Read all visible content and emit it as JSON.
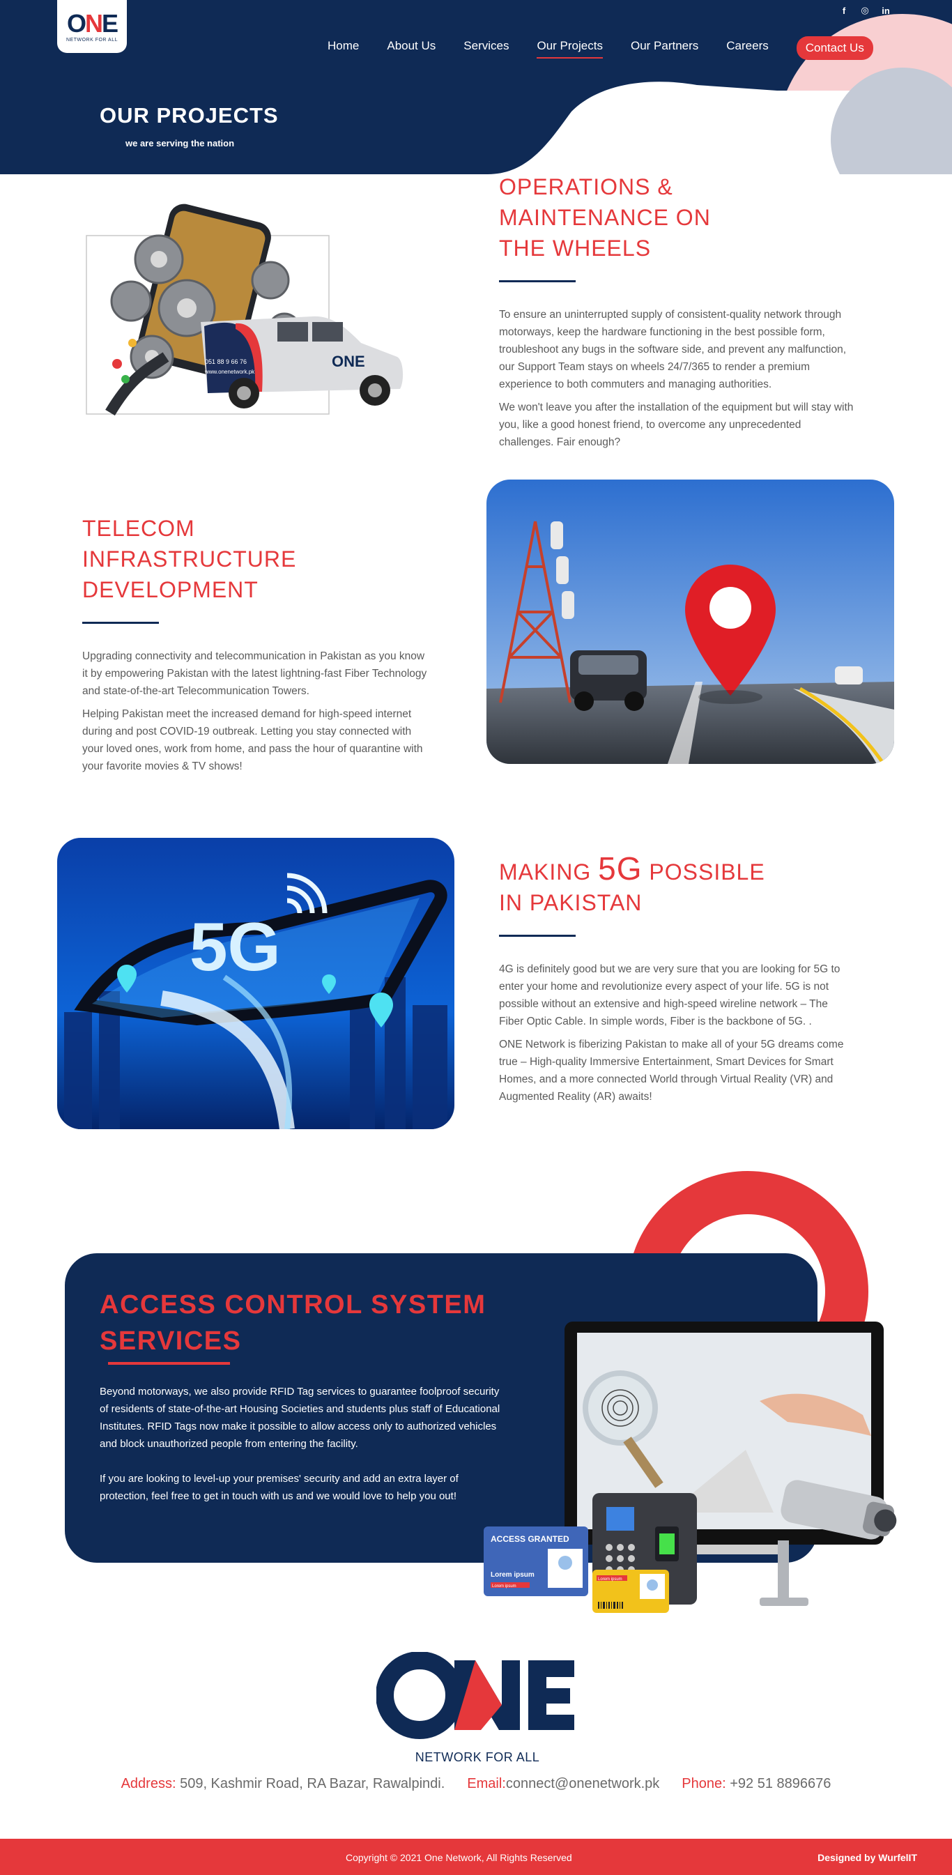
{
  "header": {
    "logo": {
      "mark": "ONE",
      "tagline": "NETWORK FOR ALL"
    },
    "social": [
      "facebook-icon",
      "instagram-icon",
      "linkedin-icon"
    ],
    "social_glyphs": {
      "facebook": "f",
      "instagram": "◎",
      "linkedin": "in"
    },
    "nav": [
      {
        "label": "Home"
      },
      {
        "label": "About Us"
      },
      {
        "label": "Services"
      },
      {
        "label": "Our Projects",
        "active": true
      },
      {
        "label": "Our Partners"
      },
      {
        "label": "Careers"
      }
    ],
    "cta": "Contact Us",
    "page_title": "OUR PROJECTS",
    "page_subtitle": "we are serving the nation"
  },
  "projects": [
    {
      "title": "OPERATIONS & MAINTENANCE ON THE WHEELS",
      "paragraphs": [
        "To ensure an uninterrupted supply of consistent-quality network through motorways, keep the hardware functioning in the best possible form, troubleshoot any bugs in the software side, and prevent any malfunction, our Support Team stays on wheels 24/7/365 to render a premium experience to both commuters and managing authorities.",
        "We won't leave you after the installation of the equipment but will stay with you, like a good honest friend, to overcome any unprecedented challenges. Fair enough?"
      ],
      "van_phone": "051 88 9 66 76",
      "van_url": "www.onenetwork.pk"
    },
    {
      "title": "TELECOM INFRASTRUCTURE DEVELOPMENT",
      "paragraphs": [
        "Upgrading connectivity and telecommunication in Pakistan as you know it by empowering Pakistan with the latest lightning-fast Fiber Technology and state-of-the-art Telecommunication Towers.",
        "Helping Pakistan meet the increased demand for high-speed internet during and post COVID-19 outbreak. Letting you stay connected with your loved ones, work from home, and pass the hour of quarantine with your favorite movies & TV shows!"
      ]
    },
    {
      "title_pre": "MAKING ",
      "title_big": "5G",
      "title_post": " POSSIBLE",
      "title_line2": "IN PAKISTAN",
      "image_label": "5G",
      "paragraphs": [
        "4G is definitely good but we are very sure that you are looking for 5G to enter your home and revolutionize every aspect of your life. 5G is not possible without an extensive and high-speed wireline network – The Fiber Optic Cable. In simple words, Fiber is the backbone of 5G. .",
        "ONE Network is fiberizing Pakistan to make all of your 5G dreams come true – High-quality Immersive Entertainment, Smart Devices for Smart Homes, and a more connected World through Virtual Reality (VR) and Augmented Reality (AR) awaits!"
      ]
    }
  ],
  "access": {
    "title_line1": "ACCESS CONTROL SYSTEM",
    "title_line2": "SERVICES",
    "paragraphs": [
      "Beyond motorways, we also provide RFID Tag services to guarantee foolproof security of residents of state-of-the-art Housing Societies and students plus staff of Educational Institutes. RFID Tags now make it possible to allow access only to authorized vehicles and block unauthorized people from entering the facility.",
      "If you are looking to level-up your premises' security and add an extra layer of protection, feel free to get in touch with us and we would love to help you out!"
    ],
    "card_header": "ACCESS GRANTED",
    "card_name": "Lorem ipsum",
    "card_sub": "Lorem ipsum",
    "card2_sub": "Lorem ipsum"
  },
  "footer": {
    "logo_mark": "ONE",
    "logo_tagline": "NETWORK FOR ALL",
    "address_label": "Address:",
    "address": "509, Kashmir Road, RA Bazar, Rawalpindi.",
    "email_label": "Email:",
    "email": "connect@onenetwork.pk",
    "phone_label": "Phone:",
    "phone": "+92 51 8896676",
    "copyright": "Copyright © 2021 One Network, All Rights Reserved",
    "designed_by": "Designed by WurfelIT"
  },
  "colors": {
    "navy": "#0f2a55",
    "red": "#e5383b",
    "pink": "#f8cfd1"
  }
}
